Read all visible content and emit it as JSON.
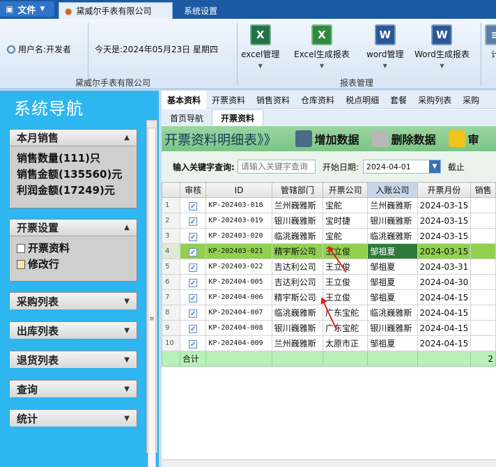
{
  "titlebar": {
    "file_label": "文件",
    "tabs": [
      "黛威尔手表有限公司",
      "系统设置"
    ]
  },
  "ribbon": {
    "user_label": "用户名:开发者",
    "date_label": "今天是:2024年05月23日 星期四",
    "company_group_label": "黛威尔手表有限公司",
    "report_group_label": "报表管理",
    "buttons": [
      {
        "label": "excel管理",
        "icon": "excel-icon",
        "color": "#217346"
      },
      {
        "label": "Excel生成报表",
        "icon": "excel-export-icon",
        "color": "#2e8b3e"
      },
      {
        "label": "word管理",
        "icon": "word-icon",
        "color": "#2b5797"
      },
      {
        "label": "Word生成报表",
        "icon": "word-export-icon",
        "color": "#2b5797"
      },
      {
        "label": "计",
        "icon": "calc-icon",
        "color": "#5a7ea8"
      }
    ]
  },
  "nav": {
    "title": "系统导航",
    "monthly": {
      "title": "本月销售",
      "qty": "销售数量(111)只",
      "amount": "销售金额(135560)元",
      "profit": "利润金额(17249)元"
    },
    "invoice": {
      "title": "开票设置",
      "items": [
        "开票资料",
        "修改行"
      ]
    },
    "collapsed": [
      "采购列表",
      "出库列表",
      "退货列表",
      "查询",
      "统计"
    ]
  },
  "content": {
    "main_tabs": [
      "基本资料",
      "开票资料",
      "销售资料",
      "仓库资料",
      "税点明细",
      "套餐",
      "采购列表",
      "采购"
    ],
    "page_tabs": [
      "首页导航",
      "开票资料"
    ],
    "title": "开票资料明细表》》",
    "add_label": "增加数据",
    "delete_label": "删除数据",
    "review_label": "审",
    "keyword_label": "输入关键字查询:",
    "keyword_placeholder": "请输入关键字查询",
    "start_date_label": "开始日期:",
    "start_date": "2024-04-01",
    "cut_label": "截止"
  },
  "table": {
    "columns": [
      "审核",
      "ID",
      "管辖部门",
      "开票公司",
      "入账公司",
      "开票月份",
      "销售"
    ],
    "rows": [
      {
        "n": "1",
        "checked": true,
        "id": "KP-202403-018",
        "dept": "兰州巍雅斯",
        "company": "宝舵",
        "account": "兰州巍雅斯",
        "month": "2024-03-15"
      },
      {
        "n": "2",
        "checked": true,
        "id": "KP-202403-019",
        "dept": "银川巍雅斯",
        "company": "宝时捷",
        "account": "银川巍雅斯",
        "month": "2024-03-15"
      },
      {
        "n": "3",
        "checked": true,
        "id": "KP-202403-020",
        "dept": "临洮巍雅斯",
        "company": "宝舵",
        "account": "临洮巍雅斯",
        "month": "2024-03-15"
      },
      {
        "n": "4",
        "checked": true,
        "id": "KP-202403-021",
        "dept": "精宇斯公司",
        "company": "王立俊",
        "account": "邹祖夏",
        "month": "2024-03-15"
      },
      {
        "n": "5",
        "checked": true,
        "id": "KP-202403-022",
        "dept": "吉达利公司",
        "company": "王立俊",
        "account": "邹祖夏",
        "month": "2024-03-31"
      },
      {
        "n": "6",
        "checked": true,
        "id": "KP-202404-005",
        "dept": "吉达利公司",
        "company": "王立俊",
        "account": "邹祖夏",
        "month": "2024-04-30"
      },
      {
        "n": "7",
        "checked": true,
        "id": "KP-202404-006",
        "dept": "精宇斯公司",
        "company": "王立俊",
        "account": "邹祖夏",
        "month": "2024-04-15"
      },
      {
        "n": "8",
        "checked": true,
        "id": "KP-202404-007",
        "dept": "临洮巍雅斯",
        "company": "广东宝舵",
        "account": "临洮巍雅斯",
        "month": "2024-04-15"
      },
      {
        "n": "9",
        "checked": true,
        "id": "KP-202404-008",
        "dept": "银川巍雅斯",
        "company": "广东宝舵",
        "account": "银川巍雅斯",
        "month": "2024-04-15"
      },
      {
        "n": "10",
        "checked": true,
        "id": "KP-202404-009",
        "dept": "兰州巍雅斯",
        "company": "太原市正",
        "account": "邹祖夏",
        "month": "2024-04-15"
      }
    ],
    "total_label": "合计",
    "total_tail": "2"
  }
}
